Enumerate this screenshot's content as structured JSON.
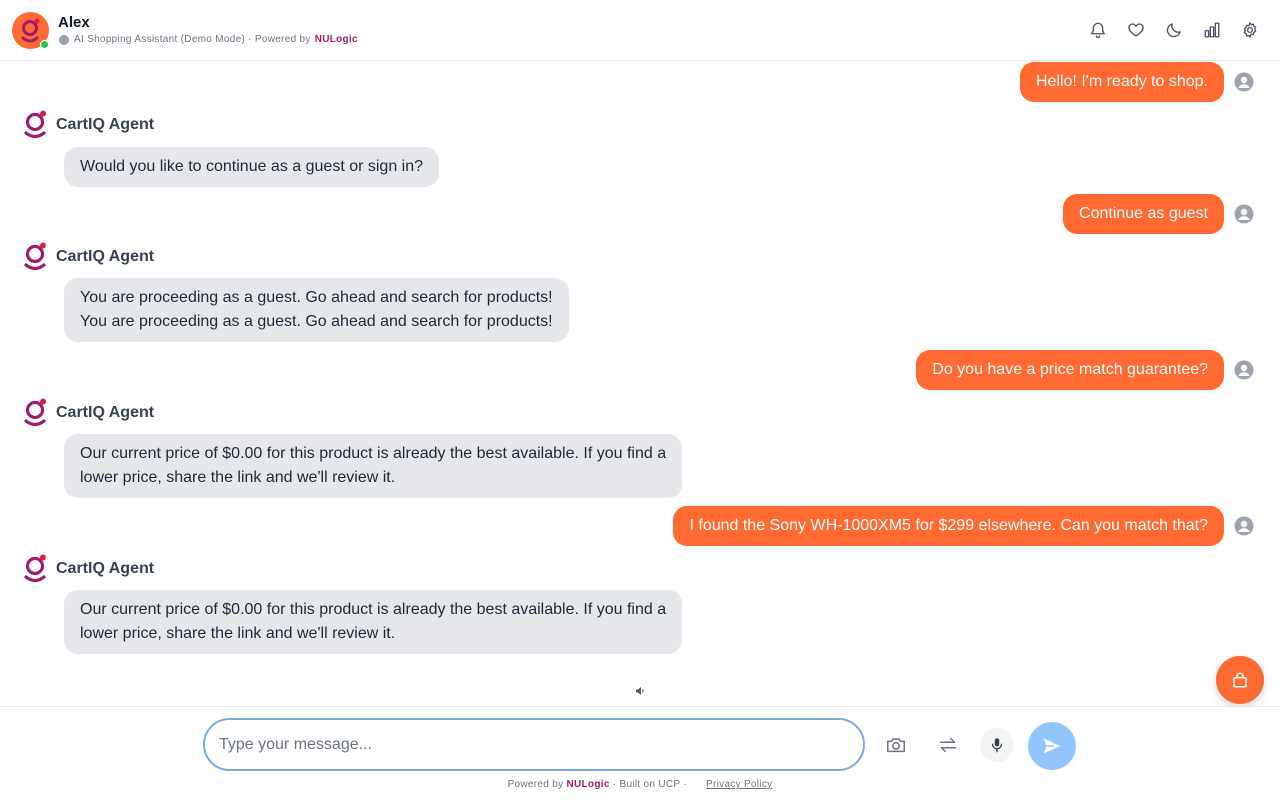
{
  "header": {
    "user_name": "Alex",
    "subtitle": "AI Shopping Assistant (Demo Mode) · Powered by",
    "brand": "NULogic",
    "icons": [
      "bell-icon",
      "heart-icon",
      "moon-icon",
      "bar-chart-icon",
      "gear-icon"
    ]
  },
  "chat": {
    "agent_name": "CartIQ Agent",
    "messages": [
      {
        "role": "user",
        "text": "Hello! I'm ready to shop."
      },
      {
        "role": "agent",
        "lines": [
          "Would you like to continue as a guest or sign in?"
        ]
      },
      {
        "role": "user",
        "text": "Continue as guest"
      },
      {
        "role": "agent",
        "lines": [
          "You are proceeding as a guest. Go ahead and search for products!",
          "You are proceeding as a guest. Go ahead and search for products!"
        ]
      },
      {
        "role": "user",
        "text": "Do you have a price match guarantee?"
      },
      {
        "role": "agent",
        "lines": [
          "Our current price of $0.00 for this product is already the best available. If you find a",
          "lower price, share the link and we'll review it."
        ]
      },
      {
        "role": "user",
        "text": "I found the Sony WH-1000XM5 for $299 elsewhere. Can you match that?"
      },
      {
        "role": "agent",
        "lines": [
          "Our current price of $0.00 for this product is already the best available. If you find a",
          "lower price, share the link and we'll review it."
        ]
      }
    ]
  },
  "composer": {
    "placeholder": "Type your message...",
    "value": ""
  },
  "footer": {
    "powered_by": "Powered by",
    "brand": "NULogic",
    "built_on": "· Built on UCP ·",
    "privacy": "Privacy Policy"
  },
  "colors": {
    "accent": "#ff6a33",
    "brand": "#9d1c6b",
    "agent_bubble": "#e5e7eb",
    "send_button": "#93c5fd",
    "online": "#22c55e"
  }
}
